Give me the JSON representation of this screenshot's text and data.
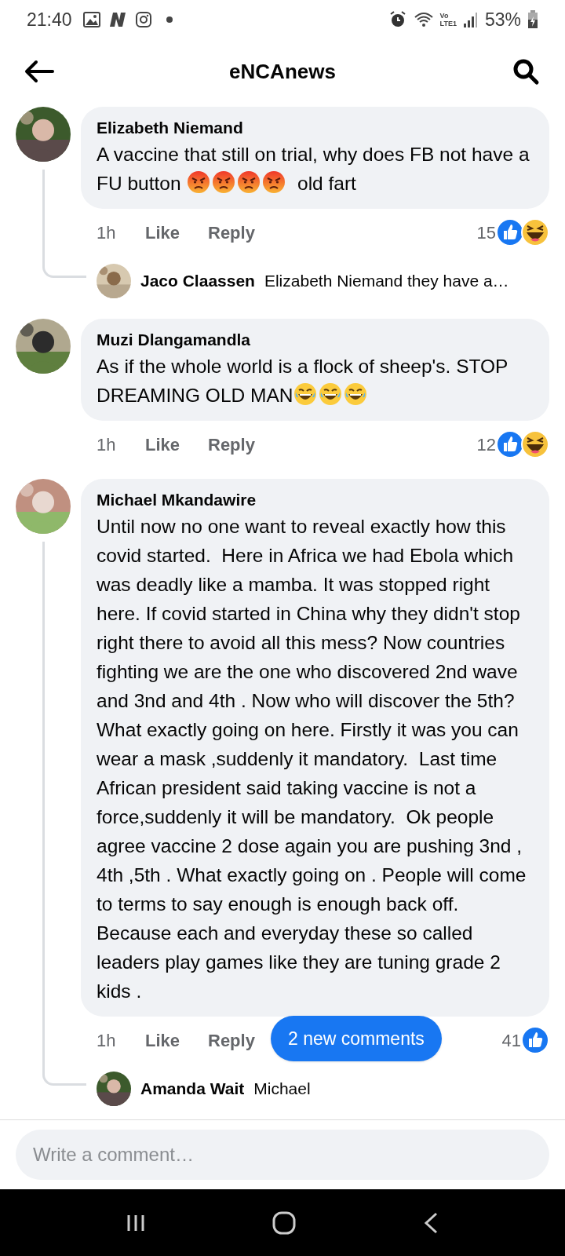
{
  "status_bar": {
    "time": "21:40",
    "network_label": "Vo\nLTE1",
    "battery": "53%"
  },
  "header": {
    "title": "eNCAnews"
  },
  "comments": [
    {
      "author": "Elizabeth Niemand",
      "body": [
        {
          "kind": "text",
          "text": "A vaccine that still on trial, why does FB not have a FU button "
        },
        {
          "kind": "angry"
        },
        {
          "kind": "angry"
        },
        {
          "kind": "angry"
        },
        {
          "kind": "angry"
        },
        {
          "kind": "text",
          "text": "  old fart"
        }
      ],
      "time": "1h",
      "like": "Like",
      "reply": "Reply",
      "reaction_count": "15",
      "reactions": [
        {
          "kind": "like"
        },
        {
          "kind": "haha"
        }
      ],
      "replies": [
        {
          "author": "Jaco Claassen",
          "text": "Elizabeth Niemand they have a…"
        }
      ]
    },
    {
      "author": "Muzi Dlangamandla",
      "body": [
        {
          "kind": "text",
          "text": "As if the whole world is a flock of sheep's. STOP DREAMING OLD MAN"
        },
        {
          "kind": "laughing"
        },
        {
          "kind": "laughing"
        },
        {
          "kind": "laughing"
        }
      ],
      "time": "1h",
      "like": "Like",
      "reply": "Reply",
      "reaction_count": "12",
      "reactions": [
        {
          "kind": "like"
        },
        {
          "kind": "haha"
        }
      ]
    },
    {
      "author": "Michael Mkandawire",
      "body": [
        {
          "kind": "text",
          "text": "Until now no one want to reveal exactly how this covid started.  Here in Africa we had Ebola which was deadly like a mamba. It was stopped right here. If covid started in China why they didn't stop right there to avoid all this mess? Now countries fighting we are the one who discovered 2nd wave and 3nd and 4th . Now who will discover the 5th? What exactly going on here. Firstly it was you can wear a mask ,suddenly it mandatory.  Last time African president said taking vaccine is not a force,suddenly it will be mandatory.  Ok people agree vaccine 2 dose again you are pushing 3nd , 4th ,5th . What exactly going on . People will come to terms to say enough is enough back off. Because each and everyday these so called leaders play games like they are tuning grade 2 kids ."
        }
      ],
      "time": "1h",
      "like": "Like",
      "reply": "Reply",
      "reaction_count": "41",
      "reactions": [
        {
          "kind": "like"
        }
      ],
      "replies": [
        {
          "author": "Amanda Wait",
          "text": "Michael"
        }
      ]
    }
  ],
  "new_comments_pill": "2 new comments",
  "composer": {
    "placeholder": "Write a comment…"
  }
}
